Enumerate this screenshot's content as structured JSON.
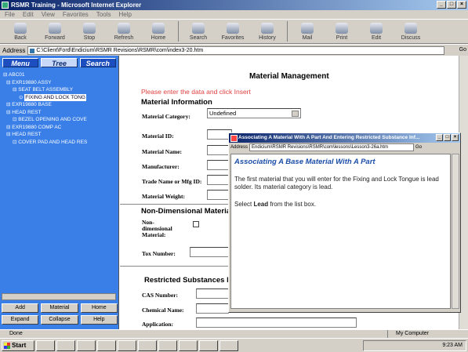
{
  "window": {
    "title": "RSMR Training - Microsoft Internet Explorer"
  },
  "menu": [
    "File",
    "Edit",
    "View",
    "Favorites",
    "Tools",
    "Help"
  ],
  "toolbar": [
    "Back",
    "Forward",
    "Stop",
    "Refresh",
    "Home",
    "Search",
    "Favorites",
    "History",
    "Mail",
    "Print",
    "Edit",
    "Discuss"
  ],
  "address": {
    "label": "Address",
    "value": "C:\\Client\\Ford\\Endicium\\RSMR Revisions\\RSMR\\com\\index3-20.htm",
    "go": "Go"
  },
  "sidebar": {
    "tabs": [
      "Menu",
      "Tree",
      "Search"
    ],
    "tree": [
      "ABC01",
      "EXR19880 ASSY",
      "SEAT BELT ASSEMBLY",
      "FIXING AND LOCK TONG",
      "EXR19880 BASE",
      "HEAD REST",
      "BEZEL OPENING AND COVE",
      "EXR19880 COMP AC",
      "HEAD REST",
      "COVER PAD AND HEAD RES"
    ],
    "buttons": [
      "Add",
      "Material",
      "Home",
      "Expand",
      "Collapse",
      "Help"
    ]
  },
  "main": {
    "title": "Material Management",
    "prompt": "Please enter the data and click Insert",
    "info_heading": "Material Information",
    "category_label": "Material Category:",
    "category_value": "Undefined",
    "labels": [
      "Material ID:",
      "Material Name:",
      "Manufacturer:",
      "Trade Name or Mfg ID:",
      "Material Weight:"
    ],
    "nondim_heading": "Non-Dimensional Material",
    "nondim_label": "Non-dimensional Material:",
    "tox_label": "Tox Number:",
    "restricted_heading": "Restricted Substances In",
    "restricted_labels": [
      "CAS Number:",
      "Chemical Name:",
      "Application:"
    ]
  },
  "popup": {
    "title": "Associating A Material With A Part And Entering Restricted Substance Inf...",
    "address_label": "Address",
    "address": "Endicium\\RSMR Revisions\\RSMR\\com\\lessons\\Lesson3-26a.htm",
    "go": "Go",
    "heading": "Associating A Base Material With A Part",
    "para1": "The first material that you will enter for the Fixing and Lock Tongue is lead solder. Its material category is lead.",
    "para2_pre": "Select ",
    "para2_bold": "Lead",
    "para2_post": " from the list box."
  },
  "status": {
    "left": "Done",
    "right": "My Computer"
  },
  "taskbar": {
    "start": "Start",
    "clock": "9:23 AM"
  }
}
